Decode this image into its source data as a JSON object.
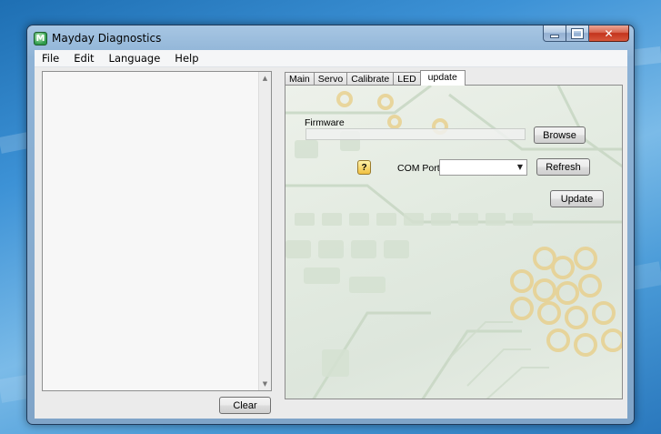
{
  "window": {
    "title": "Mayday Diagnostics",
    "app_icon_glyph": "M",
    "controls": {
      "minimize_icon": "minimize-icon",
      "maximize_icon": "maximize-icon",
      "close_icon": "close-icon",
      "close_glyph": "✕"
    }
  },
  "menu": {
    "items": [
      {
        "label": "File"
      },
      {
        "label": "Edit"
      },
      {
        "label": "Language"
      },
      {
        "label": "Help"
      }
    ]
  },
  "log": {
    "clear_label": "Clear"
  },
  "tabs": [
    {
      "label": "Main",
      "active": false
    },
    {
      "label": "Servo",
      "active": false
    },
    {
      "label": "Calibrate",
      "active": false
    },
    {
      "label": "LED",
      "active": false
    },
    {
      "label": "update",
      "active": true
    }
  ],
  "update_tab": {
    "firmware_label": "Firmware",
    "firmware_value": "",
    "browse_label": "Browse",
    "help_label": "?",
    "com_port_label": "COM Port",
    "com_port_value": "",
    "refresh_label": "Refresh",
    "update_label": "Update"
  },
  "colors": {
    "close_button": "#c3331c",
    "help_button": "#f0c040",
    "board_green": "#2f6e2b"
  }
}
